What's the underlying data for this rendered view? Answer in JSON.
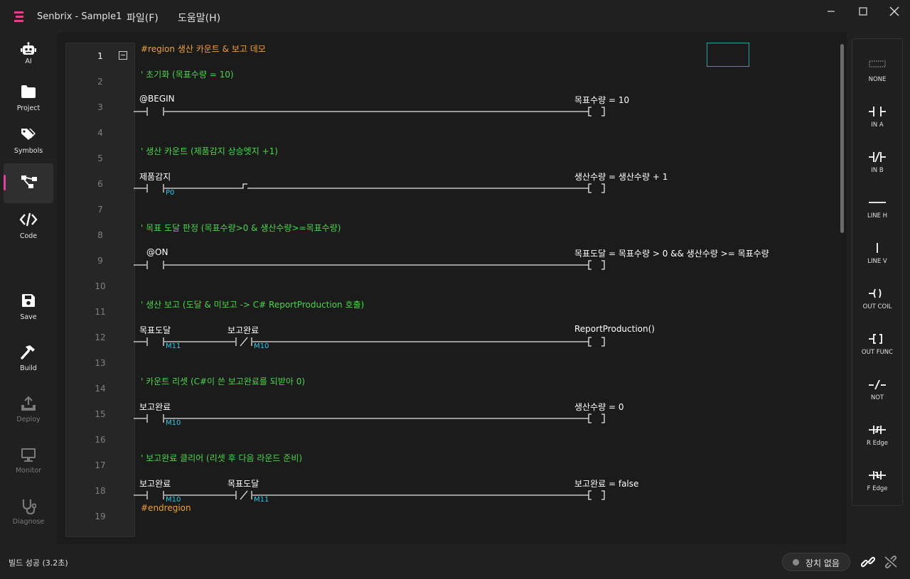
{
  "window": {
    "title": "Senbrix - Sample1",
    "menu": [
      "파일(F)",
      "도움말(H)"
    ]
  },
  "sidebar": {
    "items": [
      {
        "label": "AI",
        "icon": "robot-icon"
      },
      {
        "label": "Project",
        "icon": "folder-icon"
      },
      {
        "label": "Symbols",
        "icon": "tags-icon"
      },
      {
        "label": "",
        "icon": "diagram-icon"
      },
      {
        "label": "Code",
        "icon": "code-icon"
      },
      {
        "label": "Save",
        "icon": "save-icon"
      },
      {
        "label": "Build",
        "icon": "hammer-icon"
      },
      {
        "label": "Deploy",
        "icon": "upload-icon"
      },
      {
        "label": "Monitor",
        "icon": "monitor-icon"
      },
      {
        "label": "Diagnose",
        "icon": "stethoscope-icon"
      }
    ]
  },
  "editor": {
    "line_numbers": [
      "1",
      "2",
      "3",
      "4",
      "5",
      "6",
      "7",
      "8",
      "9",
      "10",
      "11",
      "12",
      "13",
      "14",
      "15",
      "16",
      "17",
      "18",
      "19"
    ],
    "region_start": "#region 생산 카운트 & 보고 데모",
    "region_end": "#endregion",
    "comments": [
      "' 초기화 (목표수량 = 10)",
      "' 생산 카운트 (제품감지 상승엣지 +1)",
      "' 목표 도달 판정 (목표수량>0 & 생산수량>=목표수량)",
      "' 생산 보고 (도달 & 미보고 -> C# ReportProduction 호출)",
      "' 카운트 리셋 (C#이 쓴 보고완료를 되받아 0)",
      "' 보고완료 클리어 (리셋 후 다음 라운드 준비)"
    ],
    "rungs": [
      {
        "contacts": [
          {
            "label": "@BEGIN",
            "addr": "",
            "type": "no"
          }
        ],
        "output": "목표수량 = 10"
      },
      {
        "contacts": [
          {
            "label": "제품감지",
            "addr": "P0",
            "type": "no"
          },
          {
            "label": "",
            "addr": "",
            "type": "redge"
          }
        ],
        "output": "생산수량 = 생산수량 + 1"
      },
      {
        "contacts": [
          {
            "label": "@ON",
            "addr": "",
            "type": "no"
          }
        ],
        "output": "목표도달 = 목표수량 > 0 && 생산수량 >= 목표수량"
      },
      {
        "contacts": [
          {
            "label": "목표도달",
            "addr": "M11",
            "type": "no"
          },
          {
            "label": "보고완료",
            "addr": "M10",
            "type": "nc"
          }
        ],
        "output": "ReportProduction()"
      },
      {
        "contacts": [
          {
            "label": "보고완료",
            "addr": "M10",
            "type": "no"
          }
        ],
        "output": "생산수량 = 0"
      },
      {
        "contacts": [
          {
            "label": "보고완료",
            "addr": "M10",
            "type": "no"
          },
          {
            "label": "목표도달",
            "addr": "M11",
            "type": "nc"
          }
        ],
        "output": "보고완료 = false"
      }
    ]
  },
  "palette": [
    {
      "label": "NONE",
      "icon": "none-icon"
    },
    {
      "label": "IN A",
      "icon": "contact-no-icon"
    },
    {
      "label": "IN B",
      "icon": "contact-nc-icon"
    },
    {
      "label": "LINE H",
      "icon": "line-h-icon"
    },
    {
      "label": "LINE V",
      "icon": "line-v-icon"
    },
    {
      "label": "OUT COIL",
      "icon": "out-coil-icon"
    },
    {
      "label": "OUT FUNC",
      "icon": "out-func-icon"
    },
    {
      "label": "NOT",
      "icon": "not-icon"
    },
    {
      "label": "R Edge",
      "icon": "rising-edge-icon"
    },
    {
      "label": "F Edge",
      "icon": "falling-edge-icon"
    }
  ],
  "status": {
    "build": "빌드 성공 (3.2초)",
    "device": "장치 없음"
  }
}
